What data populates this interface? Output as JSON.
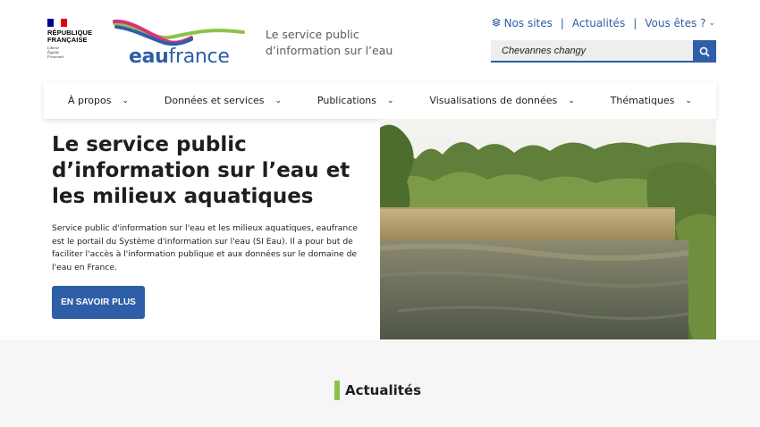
{
  "gov_logo": {
    "title_line1": "RÉPUBLIQUE",
    "title_line2": "FRANÇAISE",
    "motto1": "Liberté",
    "motto2": "Égalité",
    "motto3": "Fraternité"
  },
  "brand": {
    "name_bold": "eau",
    "name_rest": "france"
  },
  "tagline": {
    "line1": "Le service public",
    "line2": "d’information sur l’eau"
  },
  "top_links": {
    "sites": "Nos sites",
    "news": "Actualités",
    "audience": "Vous êtes ?"
  },
  "search": {
    "value": "Chevannes changy"
  },
  "nav": [
    {
      "label": "À propos"
    },
    {
      "label": "Données et services"
    },
    {
      "label": "Publications"
    },
    {
      "label": "Visualisations de données"
    },
    {
      "label": "Thématiques"
    }
  ],
  "hero": {
    "title": "Le service public d’information sur l’eau et les milieux aquatiques",
    "text": "Service public d'information sur l'eau et les milieux aquatiques, eaufrance est le portail du Système d'information sur l'eau (SI Eau). Il a pour but de faciliter l'accès à l'information publique et aux données sur le domaine de l'eau en France.",
    "button": "EN SAVOIR PLUS"
  },
  "section": {
    "title": "Actualités"
  },
  "colors": {
    "primary": "#2e5ea8",
    "accent_green": "#8bc34a",
    "flag_blue": "#000091",
    "flag_red": "#e1000f"
  }
}
